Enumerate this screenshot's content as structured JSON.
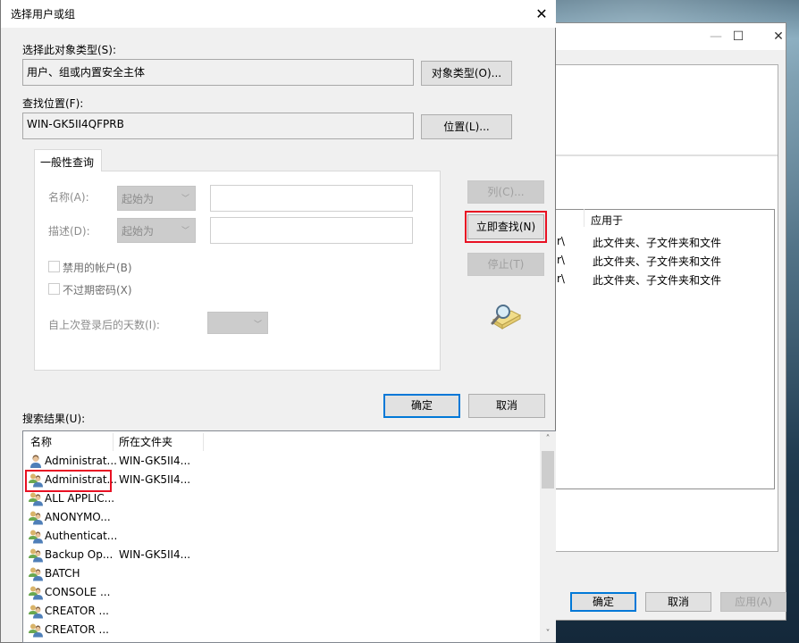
{
  "background_window": {
    "column_header_applies_to": "应用于",
    "rows": [
      {
        "path_tail": "r\\",
        "applies_to": "此文件夹、子文件夹和文件"
      },
      {
        "path_tail": "r\\",
        "applies_to": "此文件夹、子文件夹和文件"
      },
      {
        "path_tail": "r\\",
        "applies_to": "此文件夹、子文件夹和文件"
      }
    ],
    "buttons": {
      "ok": "确定",
      "cancel": "取消",
      "apply": "应用(A)"
    },
    "window_controls": {
      "minimize": "—",
      "maximize": "☐",
      "close": "✕"
    }
  },
  "dialog": {
    "title": "选择用户或组",
    "close_icon": "✕",
    "object_type_label": "选择此对象类型(S):",
    "object_type_value": "用户、组或内置安全主体",
    "object_type_button": "对象类型(O)...",
    "location_label": "查找位置(F):",
    "location_value": "WIN-GK5II4QFPRB",
    "location_button": "位置(L)...",
    "tab_label": "一般性查询",
    "query": {
      "name_label": "名称(A):",
      "name_match": "起始为",
      "name_value": "",
      "desc_label": "描述(D):",
      "desc_match": "起始为",
      "desc_value": "",
      "disabled_accounts_label": "禁用的帐户(B)",
      "disabled_accounts_checked": false,
      "non_expiring_pw_label": "不过期密码(X)",
      "non_expiring_pw_checked": false,
      "days_since_logon_label": "自上次登录后的天数(I):",
      "days_since_logon_value": ""
    },
    "side_buttons": {
      "columns": "列(C)...",
      "find_now": "立即查找(N)",
      "stop": "停止(T)"
    },
    "ok_button": "确定",
    "cancel_button": "取消",
    "results_label": "搜索结果(U):",
    "results_columns": {
      "name": "名称",
      "folder": "所在文件夹"
    },
    "results": [
      {
        "name": "Administrat...",
        "folder": "WIN-GK5II4...",
        "icon": "user-icon"
      },
      {
        "name": "Administrat...",
        "folder": "WIN-GK5II4...",
        "icon": "group-icon",
        "highlighted": true
      },
      {
        "name": "ALL APPLIC...",
        "folder": "",
        "icon": "group-icon"
      },
      {
        "name": "ANONYMO...",
        "folder": "",
        "icon": "group-icon"
      },
      {
        "name": "Authenticat...",
        "folder": "",
        "icon": "group-icon"
      },
      {
        "name": "Backup Op...",
        "folder": "WIN-GK5II4...",
        "icon": "group-icon"
      },
      {
        "name": "BATCH",
        "folder": "",
        "icon": "group-icon"
      },
      {
        "name": "CONSOLE ...",
        "folder": "",
        "icon": "group-icon"
      },
      {
        "name": "CREATOR ...",
        "folder": "",
        "icon": "group-icon"
      },
      {
        "name": "CREATOR ...",
        "folder": "",
        "icon": "group-icon"
      }
    ],
    "highlight_color": "#e81123",
    "accent_color": "#0078d7"
  }
}
